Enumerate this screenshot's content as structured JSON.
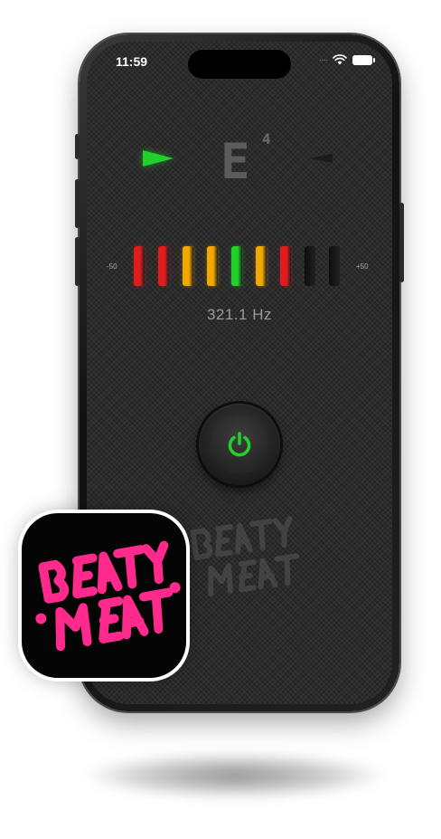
{
  "status_bar": {
    "time": "11:59"
  },
  "tuner": {
    "note": "E",
    "octave": "4",
    "scale_min": "-50",
    "scale_max": "+50",
    "frequency": "321.1 Hz",
    "meter_segments": [
      {
        "color": "#e01c1c",
        "lit": true
      },
      {
        "color": "#e01c1c",
        "lit": true
      },
      {
        "color": "#f2a800",
        "lit": true
      },
      {
        "color": "#f2a800",
        "lit": true
      },
      {
        "color": "#22d02a",
        "lit": true
      },
      {
        "color": "#f2a800",
        "lit": true
      },
      {
        "color": "#e01c1c",
        "lit": true
      },
      {
        "color": "#1a1a1a",
        "lit": false
      },
      {
        "color": "#1a1a1a",
        "lit": false
      }
    ],
    "colors": {
      "in_tune": "#1fd12a",
      "power": "#1fd12a"
    }
  },
  "icons": {
    "power": "power-icon",
    "arrow_flat": "arrow-right-indicator",
    "arrow_sharp": "arrow-left-indicator"
  },
  "logo": {
    "line1": "BEATY",
    "line2": "MEAT",
    "brand_color": "#ff2a8c"
  }
}
